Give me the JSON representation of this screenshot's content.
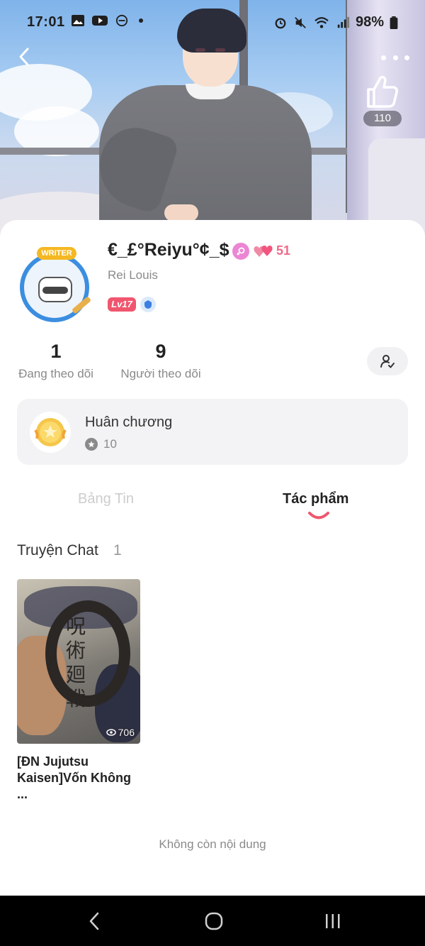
{
  "status_bar": {
    "time": "17:01",
    "battery": "98%"
  },
  "header": {
    "like_count": "110"
  },
  "profile": {
    "username": "€_£°Reiyu°¢_$",
    "heart_count": "51",
    "subname": "Rei Louis",
    "level": "Lv17",
    "avatar_badge": "WRITER"
  },
  "stats": {
    "following": {
      "value": "1",
      "label": "Đang theo dõi"
    },
    "followers": {
      "value": "9",
      "label": "Người theo dõi"
    }
  },
  "medal": {
    "title": "Huân chương",
    "count": "10"
  },
  "tabs": [
    {
      "label": "Bảng Tin",
      "active": false
    },
    {
      "label": "Tác phẩm",
      "active": true
    }
  ],
  "works": {
    "section_title": "Truyện Chat",
    "section_count": "1",
    "items": [
      {
        "title": "[ĐN Jujutsu Kaisen]Vốn Không ...",
        "views": "706",
        "cover_text": "呪術廻戦"
      }
    ]
  },
  "footer": {
    "no_more": "Không còn nội dung"
  },
  "colors": {
    "accent": "#f0566e",
    "heart": "#f06a8a",
    "gender_badge": "#ec86d4"
  }
}
